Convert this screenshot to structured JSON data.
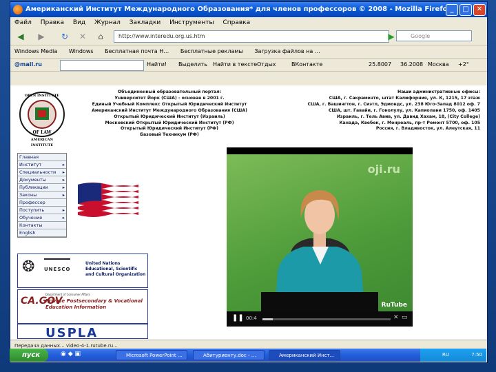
{
  "window": {
    "title": "Американский Институт Международного Образования* для членов профессоров © 2008 - Mozilla Firefox",
    "min": "_",
    "max": "□",
    "close": "✕"
  },
  "menu": [
    "Файл",
    "Правка",
    "Вид",
    "Журнал",
    "Закладки",
    "Инструменты",
    "Справка"
  ],
  "nav": {
    "url": "http://www.interedu.org.us.htm",
    "search_placeholder": "Google"
  },
  "bookmarks": [
    "Windows Media",
    "Windows",
    "Бесплатная почта H…",
    "Бесплатные рекламы",
    "Загрузка файлов на …"
  ],
  "toolbar2": {
    "mail": "@mail.ru",
    "find": "Найти!",
    "highlight": "Выделить",
    "find_in_text": "Найти в тексте",
    "weather": "Отдых",
    "vk": "ВКонтакте",
    "rate1": "25.8007",
    "rate2": "36.2008",
    "moscow": "Москва",
    "temp": "+2°"
  },
  "site": {
    "logo_lines": [
      "OPEN INSTITUTE",
      "OF LAW",
      "AMERICAN",
      "INSTITUTE"
    ],
    "header_left": [
      "Объединенный образовательный портал:",
      "Университет Йорк (США) - основан в 2001 г.",
      "Единый Учебный Комплекс Открытый Юридический Институт",
      "Американский Институт Международного Образования (США)",
      "Открытый Юридический Институт (Израиль)",
      "Московский Открытый Юридический Институт (РФ)",
      "Открытый Юридический Институт (РФ)",
      "Базовый Техникум (РФ)"
    ],
    "header_right": [
      "Наши административные офисы:",
      "США, г. Сакраменто, штат Калифорния, ул. К, 1215, 17 этаж",
      "США, г. Вашингтон, г. Сиэтл, Эдмондс, ул. 238 Юго-Запад 8012 оф. 7",
      "США, шт. Гавайи, г. Гонолулу, ул. Капиолани 1750, оф. 1405",
      "Израиль, г. Тель Авив, ул. Давид Хахам, 18, (City College)",
      "Канада, Квебек, г. Монреаль, пр-т Ремонт 5700, оф. 105",
      "Россия, г. Владивосток, ул. Алеутская, 11"
    ],
    "side_menu": [
      {
        "label": "Главная",
        "arrow": ""
      },
      {
        "label": "Институт",
        "arrow": "▸"
      },
      {
        "label": "Специальности",
        "arrow": "▸"
      },
      {
        "label": "Документы",
        "arrow": "▸"
      },
      {
        "label": "Публикации",
        "arrow": "▸"
      },
      {
        "label": "Законы",
        "arrow": "▸"
      },
      {
        "label": "Профессор",
        "arrow": ""
      },
      {
        "label": "Поступить",
        "arrow": "▸"
      },
      {
        "label": "Обучение",
        "arrow": "▸"
      },
      {
        "label": "Контакты",
        "arrow": ""
      },
      {
        "label": "English",
        "arrow": ""
      }
    ],
    "unesco": {
      "logo": "UNESCO",
      "text": "United Nations Educational, Scientific and Cultural Organization"
    },
    "bppe": {
      "dept": "Department of Consumer Affairs",
      "text": "Private Postsecondary & Vocational Education Information",
      "ca": "CA.GOV"
    },
    "uspla": "USPLA"
  },
  "video": {
    "watermark": "oji.ru",
    "rutube": "RuTube",
    "time": "00:4",
    "progress": 0.08
  },
  "status": "Передача данных... video-4-1.rutube.ru...",
  "taskbar": {
    "start": "пуск",
    "tasks": [
      "Microsoft PowerPoint ...",
      "Абитуриенту.doc - ...",
      "Американский Инст..."
    ],
    "lang": "RU",
    "clock": "7:50"
  }
}
